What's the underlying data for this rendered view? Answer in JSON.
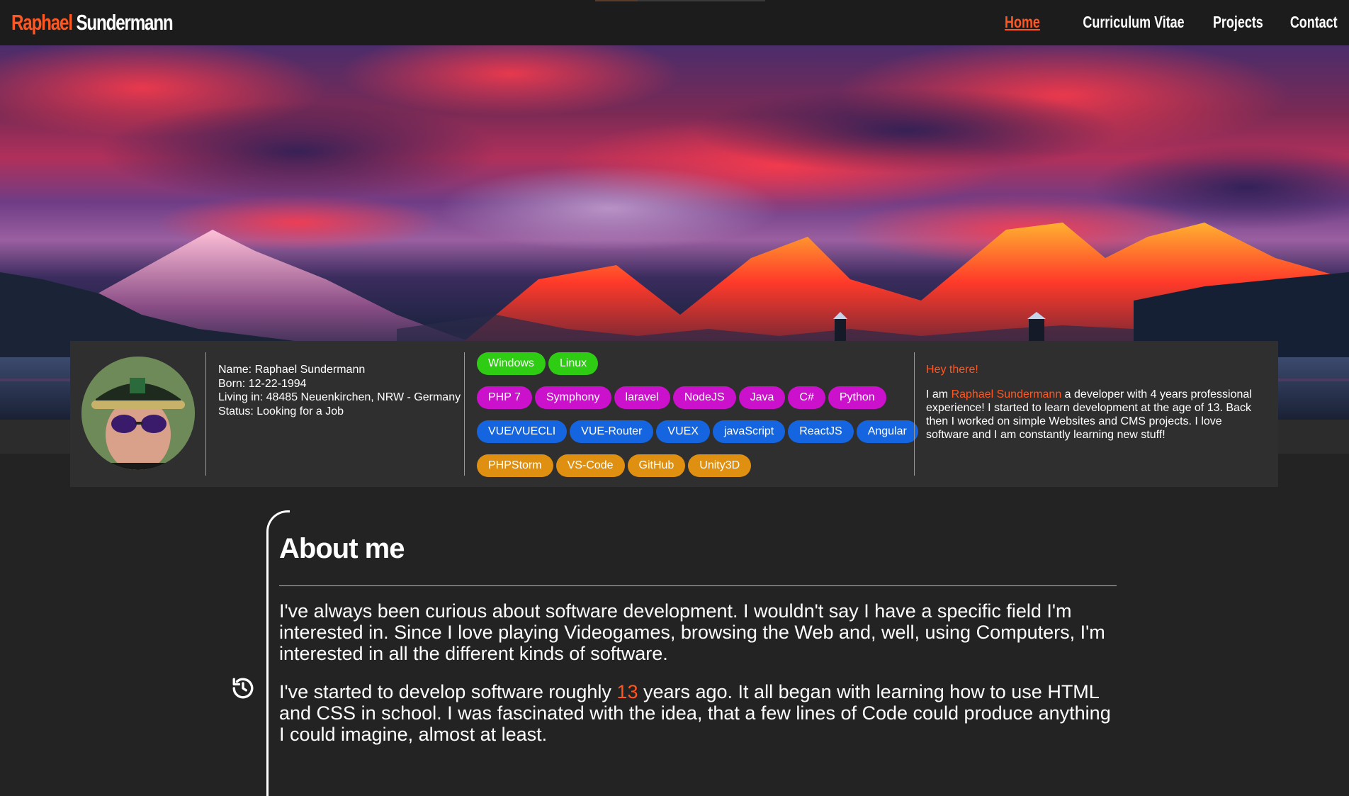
{
  "header": {
    "brand_first": "Raphael",
    "brand_last": "Sundermann",
    "nav": [
      "Home",
      "Curriculum Vitae",
      "Projects",
      "Contact"
    ],
    "active_nav": "Home"
  },
  "profile": {
    "name": "Name: Raphael Sundermann",
    "born": "Born: 12-22-1994",
    "living": "Living in: 48485 Neuenkirchen, NRW - Germany",
    "status": "Status: Looking for a Job"
  },
  "tags": {
    "os": [
      "Windows",
      "Linux"
    ],
    "languages": [
      "PHP 7",
      "Symphony",
      "laravel",
      "NodeJS",
      "Java",
      "C#",
      "Python"
    ],
    "frontend": [
      "VUE/VUECLI",
      "VUE-Router",
      "VUEX",
      "javaScript",
      "ReactJS",
      "Angular"
    ],
    "tools": [
      "PHPStorm",
      "VS-Code",
      "GitHub",
      "Unity3D"
    ]
  },
  "intro": {
    "greeting": "Hey there!",
    "text_prefix": "I am ",
    "highlight": "Raphael Sundermann",
    "text_rest": " a developer with 4 years professional experience! I started to learn development at the age of 13. Back then I worked on simple Websites and CMS projects. I love software and I am constantly learning new stuff!"
  },
  "about": {
    "title": "About me",
    "p1": "I've always been curious about software development. I wouldn't say I have a specific field I'm interested in. Since I love playing Videogames, browsing the Web and, well, using Computers, I'm interested in all the different kinds of software.",
    "p2_prefix": "I've started to develop software roughly ",
    "p2_highlight": "13",
    "p2_rest": " years ago. It all began with learning how to use HTML and CSS in school. I was fascinated with the idea, that a few lines of Code could produce anything I could imagine, almost at least."
  },
  "colors": {
    "accent": "#ff5722",
    "os_tag": "#2ecc12",
    "language_tag": "#cc11cc",
    "frontend_tag": "#1565e0",
    "tools_tag": "#e09010"
  },
  "icons": {
    "history": "history-icon"
  }
}
